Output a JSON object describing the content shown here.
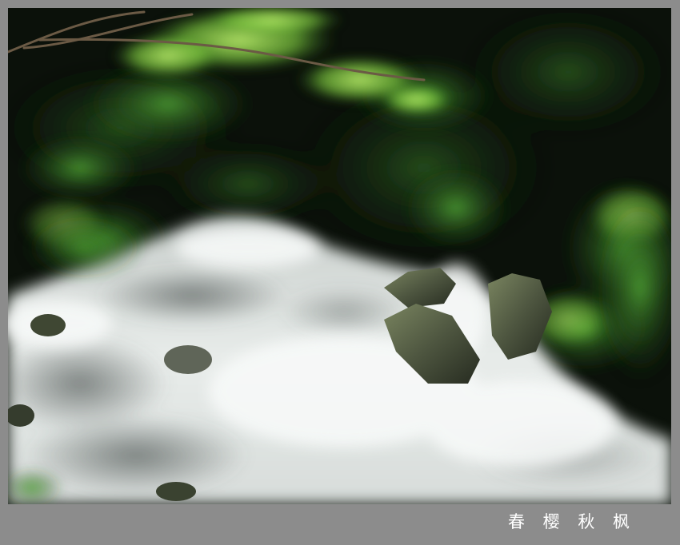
{
  "caption": {
    "text": "春 樱 秋 枫"
  },
  "colors": {
    "border": "#8c8c8c",
    "foliage_dark": "#0c140b",
    "foliage_bright": "#7fcf4a",
    "water": "#e6ebe8",
    "rock": "#4e5640",
    "caption_text": "#ffffff"
  }
}
